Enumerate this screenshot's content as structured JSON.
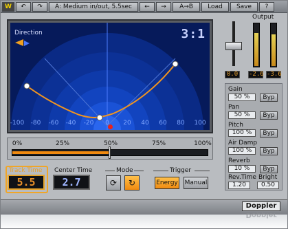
{
  "toolbar": {
    "logo": "W",
    "undo": "↶",
    "redo": "↷",
    "preset": "A: Medium in/out, 5.5sec",
    "prev": "←",
    "next": "→",
    "ab": "A→B",
    "load": "Load",
    "save": "Save",
    "help": "?"
  },
  "display": {
    "direction_label": "Direction",
    "ratio": "3:1",
    "x_ticks": [
      "-100",
      "-80",
      "-60",
      "-40",
      "-20",
      "0",
      "20",
      "40",
      "60",
      "80",
      "100"
    ]
  },
  "progress": {
    "labels": [
      "0%",
      "25%",
      "50%",
      "75%",
      "100%"
    ],
    "fill_fraction": 0.5
  },
  "track_time": {
    "label": "Track Time",
    "value": "5.5"
  },
  "center_time": {
    "label": "Center Time",
    "value": "2.7"
  },
  "mode": {
    "label": "Mode",
    "btn1": "⟳",
    "btn2": "↻"
  },
  "trigger": {
    "label": "Trigger",
    "energy": "Energy",
    "manual": "Manual"
  },
  "output": {
    "label": "Output",
    "gain_value": "0.0",
    "meter_left": "-2.6",
    "meter_right": "-3.6"
  },
  "params": [
    {
      "label": "Gain",
      "value": "50 %",
      "byp": "Byp"
    },
    {
      "label": "Pan",
      "value": "50 %",
      "byp": "Byp"
    },
    {
      "label": "Pitch",
      "value": "100 %",
      "byp": "Byp"
    },
    {
      "label": "Air Damp",
      "value": "100 %",
      "byp": "Byp"
    },
    {
      "label": "Reverb",
      "value": "10 %",
      "byp": "Byp"
    }
  ],
  "rev_time": {
    "label": "Rev.Time",
    "value": "1.20"
  },
  "bright": {
    "label": "Bright",
    "value": "0.50"
  },
  "brand": "Doppler",
  "colors": {
    "accent": "#f08a10",
    "display_bg": "#061a5a"
  }
}
